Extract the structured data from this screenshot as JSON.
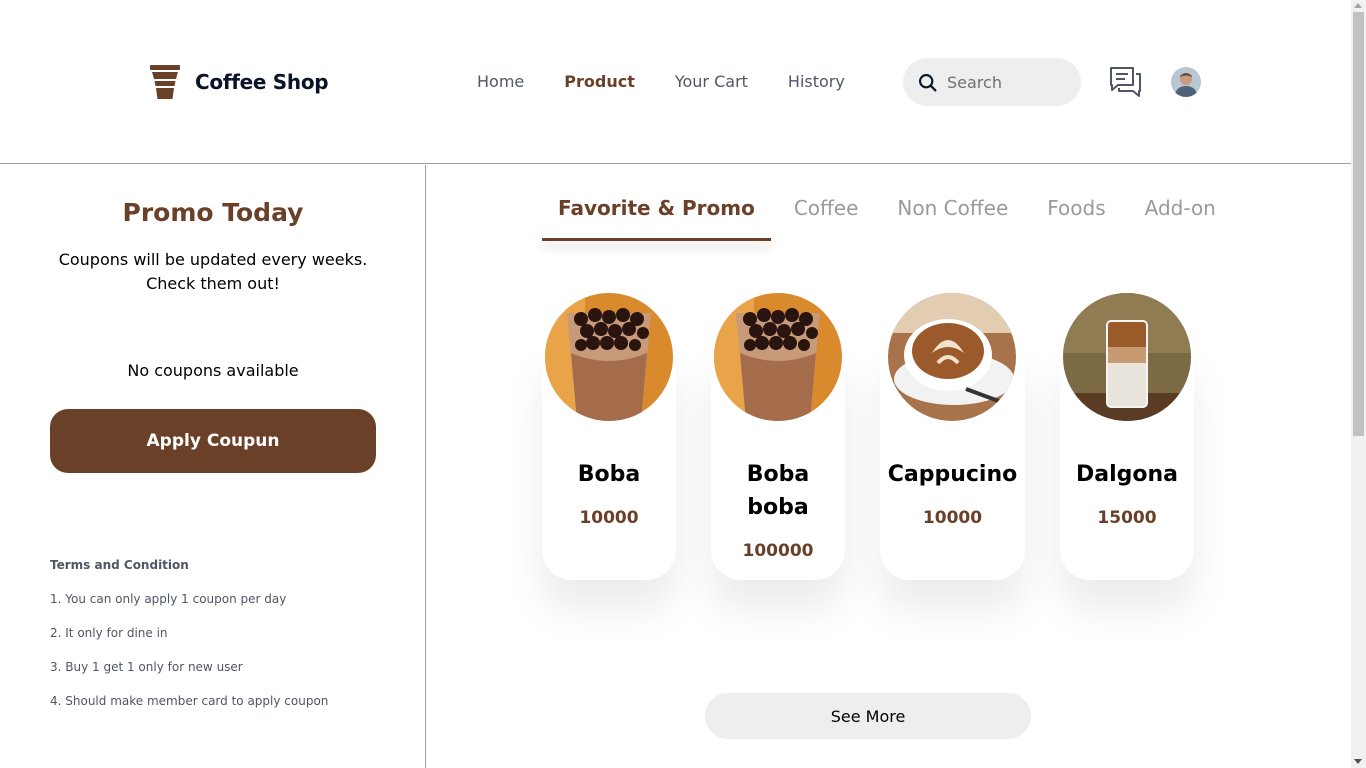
{
  "header": {
    "brand": "Coffee Shop",
    "nav": [
      {
        "label": "Home",
        "active": false
      },
      {
        "label": "Product",
        "active": true
      },
      {
        "label": "Your Cart",
        "active": false
      },
      {
        "label": "History",
        "active": false
      }
    ],
    "search": {
      "placeholder": "Search",
      "value": ""
    },
    "icons": {
      "logo": "coffee-cup-icon",
      "search": "search-icon",
      "chat": "chat-icon"
    }
  },
  "sidebar": {
    "title": "Promo Today",
    "subtitle": "Coupons will be updated every weeks. Check them out!",
    "empty_text": "No coupons available",
    "apply_label": "Apply Coupun",
    "terms_title": "Terms and Condition",
    "terms": [
      "1. You can only apply 1 coupon per day",
      "2. It only for dine in",
      "3. Buy 1 get 1 only for new user",
      "4. Should make member card to apply coupon"
    ]
  },
  "main": {
    "tabs": [
      {
        "label": "Favorite & Promo",
        "active": true
      },
      {
        "label": "Coffee",
        "active": false
      },
      {
        "label": "Non Coffee",
        "active": false
      },
      {
        "label": "Foods",
        "active": false
      },
      {
        "label": "Add-on",
        "active": false
      }
    ],
    "products": [
      {
        "name": "Boba",
        "price": "10000"
      },
      {
        "name": "Boba boba",
        "price": "100000"
      },
      {
        "name": "Cappucino",
        "price": "10000"
      },
      {
        "name": "Dalgona",
        "price": "15000"
      }
    ],
    "see_more_label": "See More"
  },
  "colors": {
    "brand": "#6a4029",
    "text_dark": "#0b132a",
    "text_muted": "#4f5665",
    "surface": "#efeeee"
  }
}
